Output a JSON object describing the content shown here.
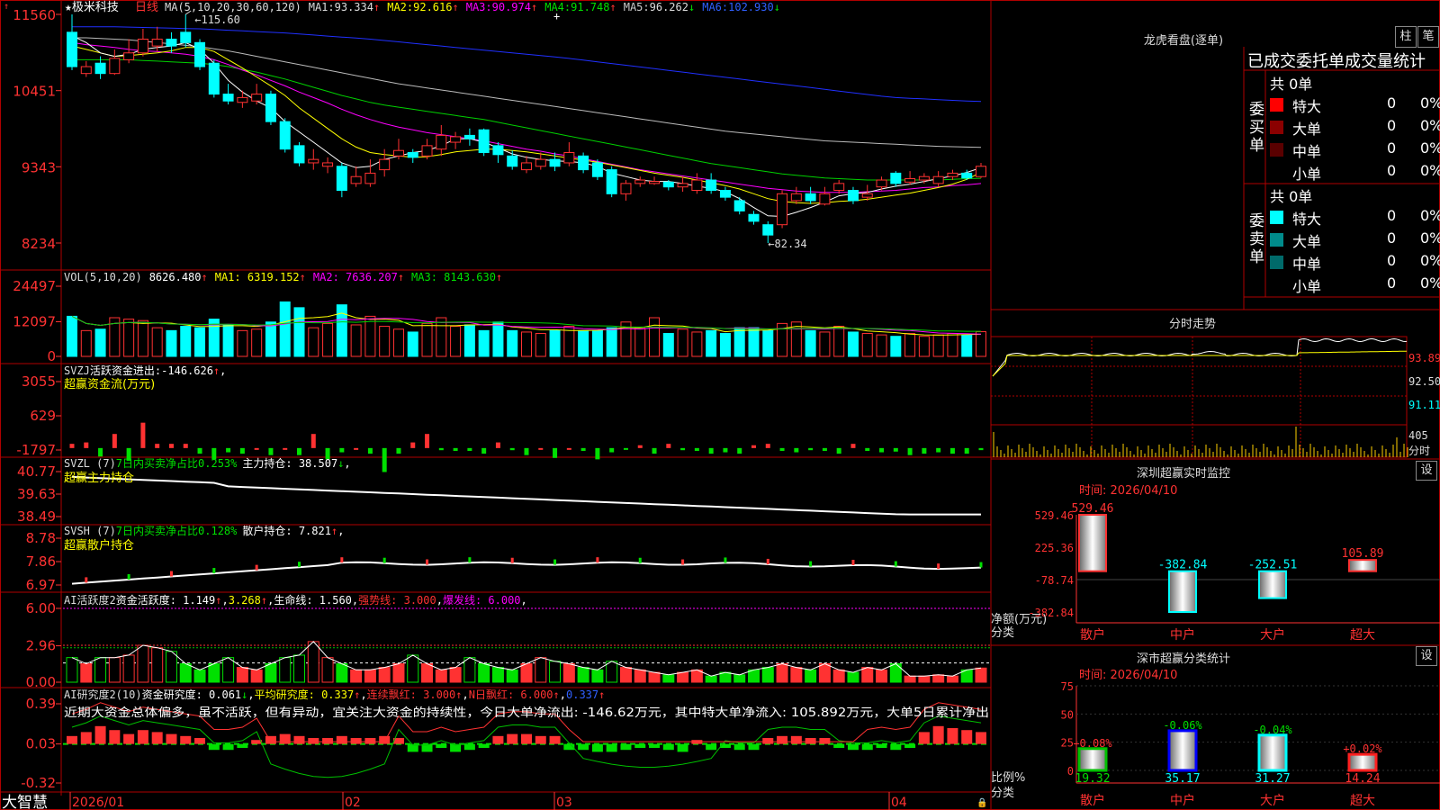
{
  "stock": {
    "name": "极米科技",
    "period": "日线",
    "star": "★"
  },
  "colors": {
    "up": "#ff3232",
    "down": "#00ffff",
    "green": "#00e000",
    "frame": "#b00000",
    "yellow": "#ffff00",
    "magenta": "#ff00ff",
    "ma6": "#0000ff",
    "white": "#ffffff"
  },
  "price_axis": {
    "ticks": [
      "11560",
      "10451",
      "9343",
      "8234"
    ]
  },
  "ma_header": {
    "params": "MA(5,10,20,30,60,120)",
    "items": [
      {
        "label": "MA1:",
        "value": "93.334",
        "arrow": "↑",
        "color": "#ffffff"
      },
      {
        "label": "MA2:",
        "value": "92.616",
        "arrow": "↑",
        "color": "#ffff00"
      },
      {
        "label": "MA3:",
        "value": "90.974",
        "arrow": "↑",
        "color": "#ff00ff"
      },
      {
        "label": "MA4:",
        "value": "91.748",
        "arrow": "↑",
        "color": "#00e000"
      },
      {
        "label": "MA5:",
        "value": "96.262",
        "arrow": "↓",
        "color": "#cccccc"
      },
      {
        "label": "MA6:",
        "value": "102.930",
        "arrow": "↓",
        "color": "#3060ff"
      }
    ]
  },
  "annotations": {
    "high": "115.60",
    "low": "82.34"
  },
  "candles": [
    [
      113.0,
      108.0,
      115.6,
      107.5
    ],
    [
      107.0,
      108.0,
      108.8,
      106.5
    ],
    [
      108.5,
      107.0,
      109.5,
      106.2
    ],
    [
      107.0,
      109.2,
      110.5,
      106.8
    ],
    [
      109.0,
      110.0,
      112.0,
      108.5
    ],
    [
      110.0,
      112.0,
      113.5,
      109.5
    ],
    [
      111.0,
      112.0,
      113.8,
      110.2
    ],
    [
      112.0,
      111.0,
      113.0,
      110.0
    ],
    [
      113.0,
      111.5,
      115.6,
      110.8
    ],
    [
      111.5,
      108.0,
      112.0,
      107.5
    ],
    [
      108.5,
      104.0,
      109.0,
      103.5
    ],
    [
      104.0,
      103.0,
      105.5,
      102.5
    ],
    [
      102.8,
      103.5,
      104.5,
      102.0
    ],
    [
      103.0,
      104.0,
      105.5,
      102.5
    ],
    [
      104.0,
      100.0,
      104.5,
      99.5
    ],
    [
      100.0,
      96.0,
      100.5,
      95.5
    ],
    [
      96.5,
      94.0,
      97.0,
      93.5
    ],
    [
      94.0,
      94.5,
      96.0,
      93.0
    ],
    [
      93.5,
      94.0,
      94.8,
      92.5
    ],
    [
      93.5,
      90.0,
      94.0,
      89.0
    ],
    [
      91.0,
      92.0,
      93.5,
      90.5
    ],
    [
      91.0,
      92.5,
      94.5,
      90.5
    ],
    [
      93.0,
      94.5,
      96.0,
      92.0
    ],
    [
      95.0,
      95.8,
      97.5,
      94.5
    ],
    [
      95.5,
      94.8,
      96.0,
      94.0
    ],
    [
      95.0,
      96.5,
      97.5,
      94.5
    ],
    [
      96.0,
      98.0,
      99.5,
      95.0
    ],
    [
      97.0,
      97.8,
      98.5,
      96.0
    ],
    [
      98.0,
      97.5,
      99.0,
      96.5
    ],
    [
      98.8,
      95.5,
      99.0,
      95.0
    ],
    [
      96.5,
      95.2,
      97.0,
      94.0
    ],
    [
      95.0,
      93.5,
      95.8,
      93.0
    ],
    [
      93.0,
      94.0,
      95.0,
      92.5
    ],
    [
      93.5,
      94.5,
      95.5,
      93.0
    ],
    [
      94.5,
      93.5,
      95.5,
      92.8
    ],
    [
      94.0,
      95.5,
      97.0,
      93.5
    ],
    [
      95.0,
      93.0,
      95.5,
      92.5
    ],
    [
      94.0,
      92.0,
      94.5,
      91.5
    ],
    [
      93.0,
      89.5,
      93.5,
      89.0
    ],
    [
      89.5,
      91.0,
      91.5,
      88.5
    ],
    [
      91.0,
      91.5,
      92.0,
      90.5
    ],
    [
      91.0,
      91.3,
      92.0,
      90.8
    ],
    [
      91.2,
      90.5,
      91.5,
      90.0
    ],
    [
      90.5,
      91.0,
      92.0,
      89.8
    ],
    [
      90.0,
      91.5,
      92.5,
      89.5
    ],
    [
      91.5,
      90.0,
      92.5,
      89.5
    ],
    [
      90.0,
      89.0,
      90.5,
      88.5
    ],
    [
      88.5,
      87.0,
      89.0,
      86.5
    ],
    [
      86.5,
      85.5,
      87.0,
      85.0
    ],
    [
      85.0,
      83.5,
      85.5,
      82.34
    ],
    [
      85.0,
      89.5,
      90.0,
      84.5
    ],
    [
      88.5,
      89.5,
      90.5,
      88.0
    ],
    [
      89.5,
      88.5,
      90.5,
      88.0
    ],
    [
      88.0,
      89.5,
      90.5,
      87.8
    ],
    [
      90.0,
      91.0,
      91.5,
      89.5
    ],
    [
      90.0,
      88.5,
      90.5,
      88.0
    ],
    [
      89.0,
      89.5,
      90.8,
      88.5
    ],
    [
      90.5,
      91.5,
      92.0,
      90.0
    ],
    [
      92.5,
      91.0,
      92.8,
      90.5
    ],
    [
      91.2,
      91.7,
      92.8,
      90.8
    ],
    [
      91.5,
      92.0,
      92.5,
      91.0
    ],
    [
      91.0,
      92.0,
      92.8,
      90.5
    ],
    [
      92.0,
      92.5,
      93.0,
      91.5
    ],
    [
      92.5,
      91.8,
      93.0,
      91.5
    ],
    [
      92.0,
      93.5,
      94.0,
      91.8
    ]
  ],
  "ma_lines": {
    "ma1": [
      112.5,
      111.5,
      110,
      109.5,
      109.8,
      110.5,
      110.8,
      111,
      111.5,
      110.5,
      108.5,
      106,
      104.3,
      103,
      102,
      100,
      98.5,
      97,
      95.5,
      94,
      93.3,
      93.5,
      94.5,
      95,
      95.5,
      95.8,
      96.5,
      97.5,
      97.5,
      97,
      96.2,
      95.3,
      94.8,
      94.5,
      94.3,
      94.2,
      94,
      93.5,
      92.5,
      92,
      91.5,
      91.3,
      91.3,
      91,
      90.6,
      90.3,
      89.8,
      88.8,
      87.5,
      86.3,
      86.2,
      86.8,
      87.5,
      88.3,
      89.2,
      89.5,
      89.7,
      90.2,
      90.6,
      90.9,
      91.3,
      91.7,
      92.1,
      92.6,
      93.3
    ],
    "ma2": [
      111,
      110.5,
      110,
      109.5,
      109.6,
      109.8,
      110,
      110.3,
      110.8,
      110.8,
      110.2,
      109,
      107.8,
      106.5,
      105.2,
      103.8,
      102,
      100.5,
      99,
      97.5,
      96.3,
      95.5,
      95.2,
      95,
      94.8,
      94.9,
      95.2,
      95.6,
      95.8,
      96,
      96,
      95.8,
      95.6,
      95.3,
      95,
      94.7,
      94.4,
      94.1,
      93.7,
      93.3,
      92.9,
      92.5,
      92.2,
      91.9,
      91.5,
      91.1,
      90.7,
      90.2,
      89.5,
      88.8,
      88.4,
      88.2,
      88.1,
      88.2,
      88.4,
      88.5,
      88.7,
      89,
      89.3,
      89.6,
      90,
      90.4,
      90.9,
      91.6,
      92.6
    ],
    "ma3": [
      111.5,
      111.2,
      111,
      110.8,
      110.5,
      110.3,
      110.2,
      110,
      109.8,
      109.5,
      109,
      108.3,
      107.5,
      106.8,
      106,
      105.2,
      104.3,
      103.5,
      102.7,
      101.8,
      101,
      100.3,
      99.7,
      99.2,
      98.8,
      98.4,
      98.1,
      97.8,
      97.5,
      97.2,
      96.8,
      96.4,
      96,
      95.7,
      95.3,
      95,
      94.6,
      94.2,
      93.8,
      93.4,
      93,
      92.7,
      92.4,
      92.1,
      91.8,
      91.5,
      91.2,
      90.9,
      90.6,
      90.3,
      90.1,
      89.9,
      89.8,
      89.7,
      89.7,
      89.7,
      89.8,
      89.9,
      90,
      90.2,
      90.4,
      90.5,
      90.7,
      90.8,
      91
    ],
    "ma4": [
      109,
      109,
      109,
      109,
      109,
      108.9,
      108.8,
      108.7,
      108.6,
      108.5,
      108.3,
      108,
      107.6,
      107.2,
      106.7,
      106.2,
      105.6,
      105,
      104.4,
      103.8,
      103.3,
      102.8,
      102.4,
      102.1,
      101.8,
      101.5,
      101.2,
      100.9,
      100.6,
      100.3,
      99.9,
      99.5,
      99.1,
      98.7,
      98.3,
      97.9,
      97.5,
      97.1,
      96.7,
      96.3,
      95.9,
      95.5,
      95.1,
      94.7,
      94.3,
      93.9,
      93.6,
      93.3,
      93,
      92.7,
      92.4,
      92.2,
      92,
      91.8,
      91.7,
      91.6,
      91.5,
      91.5,
      91.5,
      91.5,
      91.5,
      91.5,
      91.6,
      91.7,
      91.75
    ],
    "ma5": [
      112.2,
      112.2,
      112.1,
      112,
      111.9,
      111.7,
      111.5,
      111.3,
      111.1,
      110.9,
      110.6,
      110.3,
      109.9,
      109.5,
      109.1,
      108.7,
      108.3,
      107.9,
      107.5,
      107.1,
      106.7,
      106.3,
      105.9,
      105.5,
      105.2,
      104.9,
      104.6,
      104.3,
      104,
      103.7,
      103.4,
      103.1,
      102.8,
      102.5,
      102.2,
      101.9,
      101.6,
      101.3,
      101,
      100.7,
      100.4,
      100.1,
      99.8,
      99.5,
      99.2,
      98.9,
      98.6,
      98.4,
      98.2,
      98,
      97.8,
      97.6,
      97.4,
      97.2,
      97.1,
      97,
      96.9,
      96.8,
      96.7,
      96.6,
      96.5,
      96.4,
      96.35,
      96.3,
      96.26
    ],
    "ma6": [
      113.8,
      113.8,
      113.8,
      113.8,
      113.75,
      113.7,
      113.65,
      113.6,
      113.55,
      113.5,
      113.4,
      113.3,
      113.2,
      113.1,
      113,
      112.9,
      112.75,
      112.6,
      112.45,
      112.3,
      112.15,
      112,
      111.8,
      111.6,
      111.4,
      111.2,
      111,
      110.8,
      110.6,
      110.4,
      110.2,
      110,
      109.8,
      109.6,
      109.4,
      109.2,
      108.95,
      108.7,
      108.45,
      108.2,
      107.95,
      107.7,
      107.45,
      107.2,
      106.95,
      106.7,
      106.45,
      106.2,
      105.95,
      105.7,
      105.45,
      105.2,
      104.95,
      104.7,
      104.45,
      104.2,
      103.95,
      103.7,
      103.5,
      103.4,
      103.3,
      103.2,
      103.1,
      103,
      102.93
    ]
  },
  "vol_header": {
    "params": "VOL(5,10,20)",
    "value": "8626.480",
    "ma1": "MA1: 6319.152",
    "ma2": "MA2: 7636.207",
    "ma3": "MA3: 8143.630",
    "arrow": "↑"
  },
  "vol_axis": {
    "ticks": [
      "24497",
      "12097",
      "0"
    ]
  },
  "volumes": [
    14000,
    9000,
    9500,
    13500,
    13000,
    12500,
    10000,
    9000,
    10500,
    10000,
    13000,
    11000,
    9000,
    9500,
    12000,
    19000,
    17000,
    10000,
    11500,
    18000,
    11000,
    14000,
    10500,
    9500,
    8500,
    11500,
    13500,
    10500,
    11000,
    9000,
    12000,
    9000,
    8500,
    8000,
    9000,
    10500,
    9000,
    9000,
    10000,
    12000,
    10000,
    13500,
    8000,
    9500,
    8500,
    9000,
    8000,
    10000,
    10000,
    9000,
    11500,
    12000,
    9000,
    8500,
    10500,
    8500,
    8000,
    7500,
    7000,
    8000,
    7000,
    7500,
    8000,
    7500,
    8626
  ],
  "svzj": {
    "header_code": "SVZJ",
    "label": "活跃资金进出:",
    "value": "-146.626",
    "arrow": "↑",
    "sub": "超赢资金流(万元)",
    "ticks": [
      "3055",
      "629",
      "-1797"
    ],
    "values": [
      300,
      400,
      -600,
      1000,
      -900,
      1800,
      300,
      300,
      300,
      -400,
      -800,
      -300,
      -400,
      0,
      -500,
      0,
      -500,
      1000,
      -800,
      -300,
      0,
      -400,
      -1700,
      -400,
      400,
      1000,
      -150,
      -200,
      -200,
      -400,
      400,
      -150,
      -500,
      0,
      -700,
      0,
      -200,
      -800,
      -300,
      -100,
      200,
      -400,
      300,
      -150,
      -200,
      -400,
      -300,
      -400,
      200,
      300,
      -200,
      -300,
      -150,
      -200,
      -400,
      300,
      -200,
      -300,
      -250,
      -500,
      -400,
      -300,
      -400,
      -400,
      -146
    ]
  },
  "svzl": {
    "header_code": "SVZL (7)",
    "label1": "7日内买卖净占比0.253%",
    "label2": "主力持仓: 38.507",
    "arrow": "↓",
    "sub": "超赢主力持仓",
    "ticks": [
      "40.77",
      "39.63",
      "38.49"
    ]
  },
  "svsh": {
    "header_code": "SVSH (7)",
    "label1": "7日内买卖净占比0.128%",
    "label2": "散户持仓: 7.821",
    "arrow": "↑",
    "sub": "超赢散户持仓",
    "ticks": [
      "8.78",
      "7.86",
      "6.97"
    ]
  },
  "ai_activity": {
    "header": "AI活跃度2",
    "label": "资金活跃度: 1.149",
    "v2": "3.268",
    "life": "生命线: 1.560",
    "strong": "强势线: 3.000",
    "burst": "爆发线: 6.000",
    "ticks": [
      "6.00",
      "2.96",
      "0.00"
    ],
    "values": [
      2.0,
      1.5,
      2.0,
      2.0,
      2.2,
      3.0,
      2.8,
      2.5,
      1.5,
      1.0,
      1.5,
      2.0,
      1.2,
      1.0,
      1.5,
      2.0,
      2.2,
      3.3,
      2.0,
      1.5,
      1.0,
      1.0,
      1.2,
      1.5,
      2.2,
      1.5,
      1.0,
      1.2,
      2.0,
      1.5,
      1.2,
      1.0,
      1.5,
      2.0,
      1.7,
      1.5,
      1.2,
      1.0,
      1.7,
      1.2,
      1.0,
      0.8,
      0.6,
      0.8,
      1.0,
      0.5,
      0.8,
      0.6,
      1.0,
      1.2,
      1.5,
      1.2,
      1.0,
      1.5,
      1.0,
      0.8,
      1.2,
      1.0,
      1.5,
      0.5,
      0.5,
      0.6,
      0.5,
      1.0,
      1.15
    ]
  },
  "ai_research": {
    "header": "AI研究度2(10)",
    "label": "资金研究度: 0.061",
    "avg": "平均研究度: 0.337",
    "red": "连续飘红: 3.000",
    "nred": "N日飘红: 6.000",
    "extra": "0.337",
    "ticks": [
      "0.39",
      "0.03",
      "-0.32"
    ],
    "text": "近期大资金总体偏多，虽不活跃，但有异动，宜关注大资金的持续性，今日大单净流出: -146.62万元，其中特大单净流入: 105.892万元，大单5日累计净出",
    "values": [
      0.04,
      0.06,
      0.09,
      0.07,
      0.05,
      0.07,
      0.06,
      0.05,
      0.04,
      0.03,
      -0.03,
      -0.03,
      -0.02,
      0.02,
      0.04,
      0.05,
      0.04,
      0.03,
      0.03,
      0.04,
      0.03,
      0.03,
      0.04,
      0.03,
      -0.04,
      -0.04,
      -0.02,
      -0.04,
      -0.03,
      -0.02,
      0.04,
      0.05,
      0.05,
      0.04,
      0.04,
      -0.03,
      -0.03,
      -0.04,
      -0.04,
      -0.03,
      -0.02,
      -0.02,
      -0.03,
      -0.04,
      0.02,
      -0.03,
      -0.02,
      -0.03,
      -0.03,
      0.03,
      0.04,
      0.04,
      0.03,
      0.03,
      -0.02,
      -0.03,
      -0.03,
      -0.02,
      -0.03,
      -0.02,
      0.06,
      0.09,
      0.08,
      0.07,
      0.06
    ]
  },
  "date_axis": {
    "brand": "大智慧",
    "labels": [
      "2026/01",
      "02",
      "03",
      "04"
    ]
  },
  "lhkp": {
    "title": "龙虎看盘(逐单)",
    "btn_zhu": "柱",
    "btn_bi": "笔",
    "subtitle": "已成交委托单成交量统计",
    "buy_title": "委买单",
    "sell_title": "委卖单",
    "buy_total": "共 0单",
    "sell_total": "共 0单",
    "buy_rows": [
      {
        "name": "特大",
        "v": "0",
        "p": "0%",
        "color": "#ff0000"
      },
      {
        "name": "大单",
        "v": "0",
        "p": "0%",
        "color": "#8b0000"
      },
      {
        "name": "中单",
        "v": "0",
        "p": "0%",
        "color": "#5a0000"
      },
      {
        "name": "小单",
        "v": "0",
        "p": "0%",
        "color": "#000000"
      }
    ],
    "sell_rows": [
      {
        "name": "特大",
        "v": "0",
        "p": "0%",
        "color": "#00ffff"
      },
      {
        "name": "大单",
        "v": "0",
        "p": "0%",
        "color": "#008b8b"
      },
      {
        "name": "中单",
        "v": "0",
        "p": "0%",
        "color": "#006a6a"
      },
      {
        "name": "小单",
        "v": "0",
        "p": "0%",
        "color": "#000000"
      }
    ]
  },
  "intraday": {
    "title": "分时走势",
    "ticks": [
      "93.89",
      "92.50",
      "91.11"
    ],
    "vol_tick": "405",
    "vol_label": "分时"
  },
  "sz_monitor": {
    "title": "深圳超赢实时监控",
    "btn": "设",
    "time": "时间: 2026/04/10",
    "ticks": [
      "529.46",
      "225.36",
      "-78.74",
      "-382.84"
    ],
    "bars": [
      {
        "cat": "散户",
        "value": 529.46,
        "label": "529.46"
      },
      {
        "cat": "中户",
        "value": -382.84,
        "label": "-382.84"
      },
      {
        "cat": "大户",
        "value": -252.51,
        "label": "-252.51"
      },
      {
        "cat": "超大",
        "value": 105.89,
        "label": "105.89"
      }
    ],
    "ylabel": "净额(万元)",
    "xlabel": "分类"
  },
  "sz_class": {
    "title": "深市超赢分类统计",
    "btn": "设",
    "time": "时间: 2026/04/10",
    "ticks": [
      "75",
      "50",
      "25",
      "0"
    ],
    "bars": [
      {
        "cat": "散户",
        "value": 19.32,
        "delta": "+0.08%",
        "color": "#00c000"
      },
      {
        "cat": "中户",
        "value": 35.17,
        "delta": "-0.06%",
        "color": "#0000ff"
      },
      {
        "cat": "大户",
        "value": 31.27,
        "delta": "-0.04%",
        "color": "#00ffff"
      },
      {
        "cat": "超大",
        "value": 14.24,
        "delta": "+0.02%",
        "color": "#ff2020"
      }
    ],
    "ylabel": "比例%",
    "xlabel": "分类"
  }
}
